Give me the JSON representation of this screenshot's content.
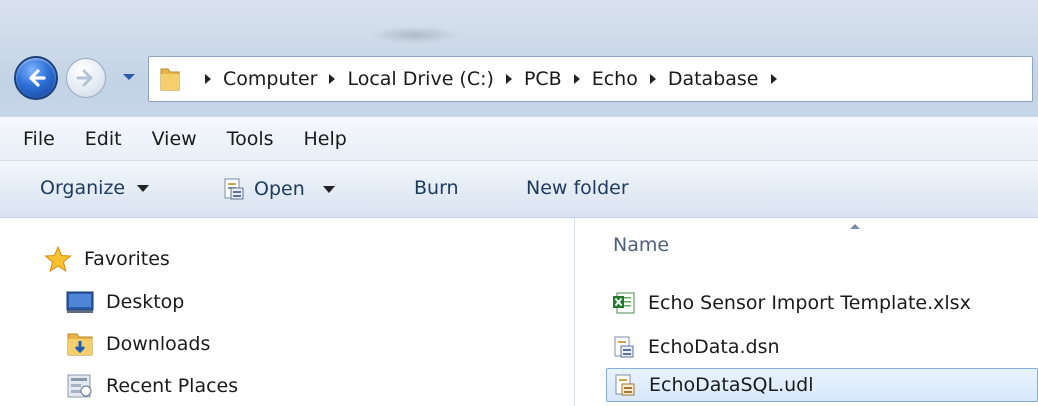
{
  "window": {
    "navigation": {
      "back_icon": "back-arrow-icon",
      "forward_icon": "forward-arrow-icon",
      "history_icon": "chevron-down-icon"
    },
    "address_bar": {
      "folder_icon": "folder-icon",
      "breadcrumbs": [
        "Computer",
        "Local Drive (C:)",
        "PCB",
        "Echo",
        "Database"
      ]
    }
  },
  "menubar": {
    "items": [
      "File",
      "Edit",
      "View",
      "Tools",
      "Help"
    ]
  },
  "toolbar": {
    "organize_label": "Organize",
    "open_label": "Open",
    "burn_label": "Burn",
    "new_folder_label": "New folder"
  },
  "navpane": {
    "favorites_label": "Favorites",
    "items": [
      {
        "label": "Desktop",
        "icon": "desktop-icon"
      },
      {
        "label": "Downloads",
        "icon": "downloads-folder-icon"
      },
      {
        "label": "Recent Places",
        "icon": "recent-places-icon"
      }
    ]
  },
  "content": {
    "column_header": "Name",
    "files": [
      {
        "name": "Echo Sensor Import Template.xlsx",
        "icon": "excel-file-icon",
        "selected": false
      },
      {
        "name": "EchoData.dsn",
        "icon": "data-source-file-icon",
        "selected": false
      },
      {
        "name": "EchoDataSQL.udl",
        "icon": "data-link-file-icon",
        "selected": true
      }
    ]
  },
  "colors": {
    "selection_fill": "#d7e8fc",
    "selection_border": "#84acdd",
    "toolbar_text": "#1e3a5f"
  }
}
